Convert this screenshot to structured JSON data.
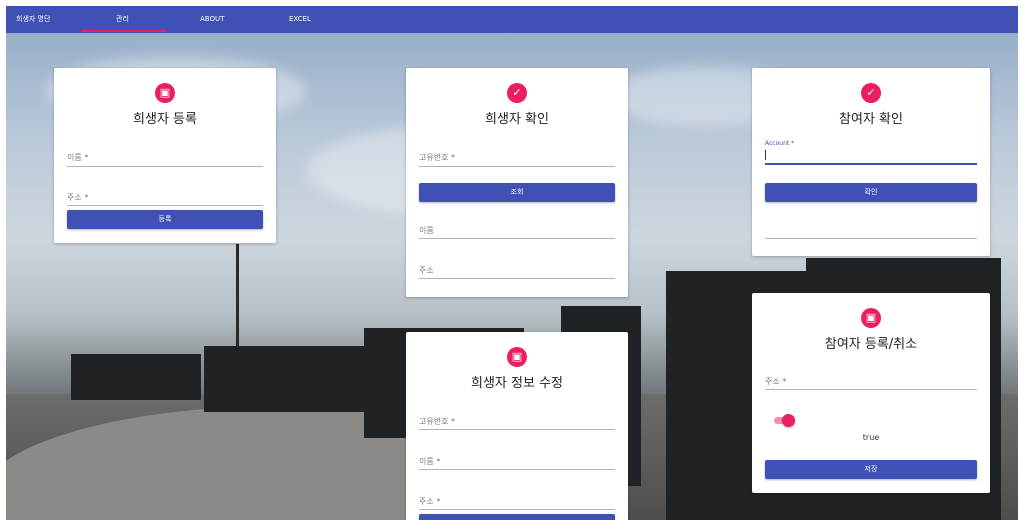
{
  "nav": {
    "items": [
      "희생자 명단",
      "관리",
      "ABOUT",
      "EXCEL"
    ],
    "active": "관리"
  },
  "colors": {
    "primary": "#3f51b5",
    "accent": "#e91e63"
  },
  "register_victim": {
    "icon": "id-card-icon",
    "title": "희생자 등록",
    "name_label": "이름 *",
    "address_label": "주소 *",
    "submit_label": "등록"
  },
  "check_victim": {
    "icon": "check-icon",
    "title": "희생자 확인",
    "id_label": "고유번호 *",
    "search_label": "조회",
    "name_label": "이름",
    "address_label": "주소"
  },
  "check_participant": {
    "icon": "check-icon",
    "title": "참여자 확인",
    "account_label": "Account *",
    "confirm_label": "확인"
  },
  "edit_victim": {
    "icon": "id-card-icon",
    "title": "희생자 정보 수정",
    "id_label": "고유번호 *",
    "name_label": "이름 *",
    "address_label": "주소 *"
  },
  "participant_register": {
    "icon": "id-card-icon",
    "title": "참여자 등록/취소",
    "address_label": "주소 *",
    "toggle_on": true,
    "toggle_value": "true",
    "save_label": "저장"
  }
}
